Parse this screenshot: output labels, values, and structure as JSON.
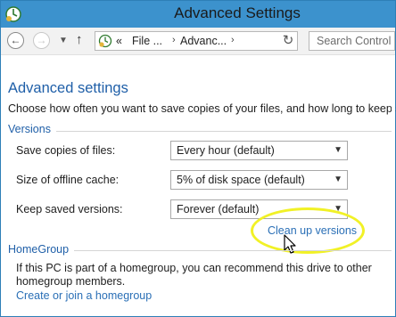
{
  "window": {
    "title": "Advanced Settings"
  },
  "nav": {
    "back_icon": "back-arrow-icon",
    "forward_icon": "forward-arrow-icon",
    "recent_icon": "chevron-down-icon",
    "up_icon": "up-arrow-icon",
    "breadcrumb_overflow": "«",
    "breadcrumb": [
      "File ...",
      "Advanc..."
    ],
    "breadcrumb_separator": "›",
    "refresh_icon": "refresh-icon",
    "search_placeholder": "Search Control"
  },
  "main": {
    "title": "Advanced settings",
    "subtitle": "Choose how often you want to save copies of your files, and how long to keep sav",
    "versions_group": {
      "label": "Versions",
      "rows": [
        {
          "label": "Save copies of files:",
          "value": "Every hour (default)"
        },
        {
          "label": "Size of offline cache:",
          "value": "5% of disk space (default)"
        },
        {
          "label": "Keep saved versions:",
          "value": "Forever (default)"
        }
      ],
      "cleanup_link": "Clean up versions"
    },
    "homegroup_group": {
      "label": "HomeGroup",
      "text": "If this PC is part of a homegroup, you can recommend this drive to other homegroup members.",
      "link": "Create or join a homegroup"
    }
  },
  "colors": {
    "titlebar": "#3c92cd",
    "accent_text": "#1f5fa8",
    "link": "#2a6fb6",
    "highlight_ellipse": "#f1f126"
  }
}
